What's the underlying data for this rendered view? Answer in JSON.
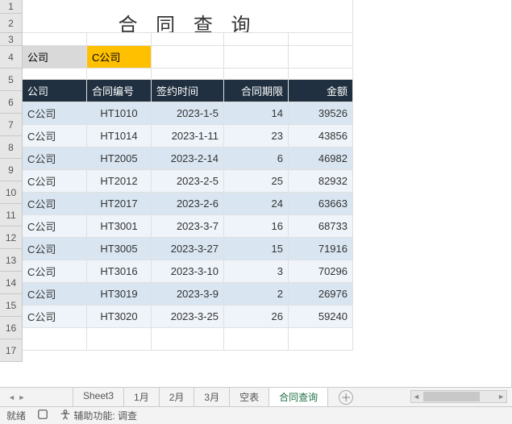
{
  "title": "合 同 查 询",
  "filter": {
    "label": "公司",
    "value": "C公司"
  },
  "headers": {
    "company": "公司",
    "contract_no": "合同编号",
    "sign_date": "签约时间",
    "term": "合同期限",
    "amount": "金额"
  },
  "rows": [
    {
      "company": "C公司",
      "contract_no": "HT1010",
      "sign_date": "2023-1-5",
      "term": 14,
      "amount": 39526
    },
    {
      "company": "C公司",
      "contract_no": "HT1014",
      "sign_date": "2023-1-11",
      "term": 23,
      "amount": 43856
    },
    {
      "company": "C公司",
      "contract_no": "HT2005",
      "sign_date": "2023-2-14",
      "term": 6,
      "amount": 46982
    },
    {
      "company": "C公司",
      "contract_no": "HT2012",
      "sign_date": "2023-2-5",
      "term": 25,
      "amount": 82932
    },
    {
      "company": "C公司",
      "contract_no": "HT2017",
      "sign_date": "2023-2-6",
      "term": 24,
      "amount": 63663
    },
    {
      "company": "C公司",
      "contract_no": "HT3001",
      "sign_date": "2023-3-7",
      "term": 16,
      "amount": 68733
    },
    {
      "company": "C公司",
      "contract_no": "HT3005",
      "sign_date": "2023-3-27",
      "term": 15,
      "amount": 71916
    },
    {
      "company": "C公司",
      "contract_no": "HT3016",
      "sign_date": "2023-3-10",
      "term": 3,
      "amount": 70296
    },
    {
      "company": "C公司",
      "contract_no": "HT3019",
      "sign_date": "2023-3-9",
      "term": 2,
      "amount": 26976
    },
    {
      "company": "C公司",
      "contract_no": "HT3020",
      "sign_date": "2023-3-25",
      "term": 26,
      "amount": 59240
    }
  ],
  "row_numbers": [
    "1",
    "2",
    "3",
    "4",
    "5",
    "6",
    "7",
    "8",
    "9",
    "10",
    "11",
    "12",
    "13",
    "14",
    "15",
    "16",
    "17"
  ],
  "tabs": [
    {
      "label": "Sheet3",
      "active": false
    },
    {
      "label": "1月",
      "active": false
    },
    {
      "label": "2月",
      "active": false
    },
    {
      "label": "3月",
      "active": false
    },
    {
      "label": "空表",
      "active": false
    },
    {
      "label": "合同查询",
      "active": true
    }
  ],
  "status": {
    "ready": "就绪",
    "accessibility": "辅助功能: 调查"
  }
}
